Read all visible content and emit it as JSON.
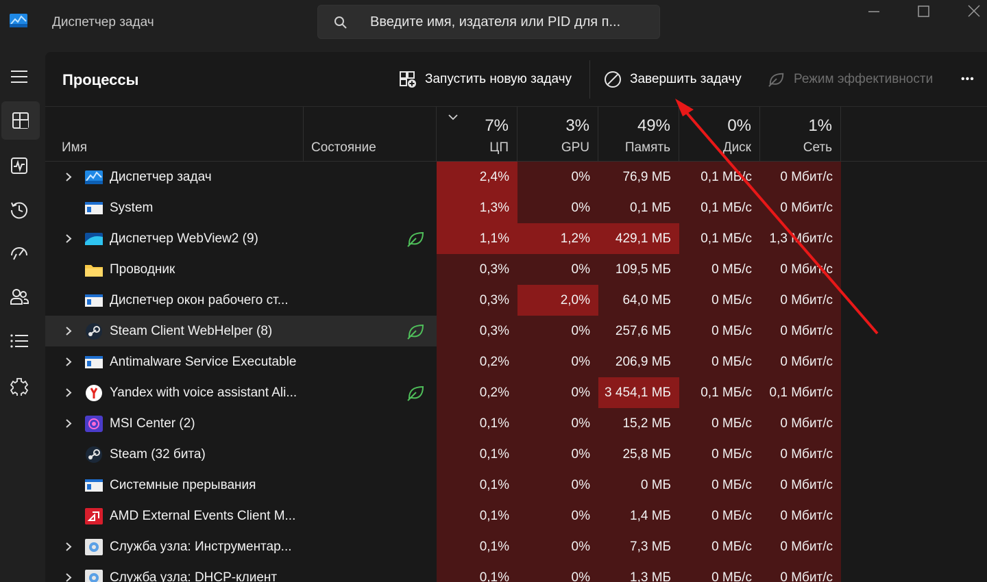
{
  "window": {
    "title": "Диспетчер задач",
    "search_placeholder": "Введите имя, издателя или PID для п..."
  },
  "nav": {
    "items": [
      {
        "icon": "hamburger-icon"
      },
      {
        "icon": "processes-icon",
        "active": true
      },
      {
        "icon": "performance-icon"
      },
      {
        "icon": "app-history-icon"
      },
      {
        "icon": "startup-apps-icon"
      },
      {
        "icon": "users-icon"
      },
      {
        "icon": "details-icon"
      },
      {
        "icon": "services-icon"
      }
    ]
  },
  "toolbar": {
    "title": "Процессы",
    "run_new_task": "Запустить новую задачу",
    "end_task": "Завершить задачу",
    "efficiency_mode": "Режим эффективности",
    "more": "•••"
  },
  "columns": {
    "name": "Имя",
    "status": "Состояние",
    "cpu": {
      "pct": "7%",
      "label": "ЦП"
    },
    "gpu": {
      "pct": "3%",
      "label": "GPU"
    },
    "memory": {
      "pct": "49%",
      "label": "Память"
    },
    "disk": {
      "pct": "0%",
      "label": "Диск"
    },
    "network": {
      "pct": "1%",
      "label": "Сеть"
    }
  },
  "colors": {
    "heat_low": "#4a1616",
    "heat_mid": "#6e1818",
    "heat_high": "#8a1a1a",
    "arrow": "#e81818"
  },
  "processes": [
    {
      "name": "Диспетчер задач",
      "icon": "taskmanager-icon",
      "expand": true,
      "eco": false,
      "cpu": "2,4%",
      "gpu": "0%",
      "mem": "76,9 МБ",
      "disk": "0,1 МБ/с",
      "net": "0 Мбит/с",
      "heat": {
        "cpu": 3,
        "gpu": 1,
        "mem": 1,
        "disk": 1,
        "net": 1
      }
    },
    {
      "name": "System",
      "icon": "system-window-icon",
      "expand": false,
      "eco": false,
      "cpu": "1,3%",
      "gpu": "0%",
      "mem": "0,1 МБ",
      "disk": "0,1 МБ/с",
      "net": "0 Мбит/с",
      "heat": {
        "cpu": 3,
        "gpu": 1,
        "mem": 1,
        "disk": 1,
        "net": 1
      }
    },
    {
      "name": "Диспетчер WebView2 (9)",
      "icon": "webview-icon",
      "expand": true,
      "eco": true,
      "cpu": "1,1%",
      "gpu": "1,2%",
      "mem": "429,1 МБ",
      "disk": "0,1 МБ/с",
      "net": "1,3 Мбит/с",
      "heat": {
        "cpu": 3,
        "gpu": 3,
        "mem": 3,
        "disk": 1,
        "net": 1
      }
    },
    {
      "name": "Проводник",
      "icon": "folder-icon",
      "expand": false,
      "eco": false,
      "cpu": "0,3%",
      "gpu": "0%",
      "mem": "109,5 МБ",
      "disk": "0 МБ/с",
      "net": "0 Мбит/с",
      "heat": {
        "cpu": 1,
        "gpu": 1,
        "mem": 1,
        "disk": 1,
        "net": 1
      }
    },
    {
      "name": "Диспетчер окон рабочего ст...",
      "icon": "system-window-icon",
      "expand": false,
      "eco": false,
      "cpu": "0,3%",
      "gpu": "2,0%",
      "mem": "64,0 МБ",
      "disk": "0 МБ/с",
      "net": "0 Мбит/с",
      "heat": {
        "cpu": 1,
        "gpu": 3,
        "mem": 1,
        "disk": 1,
        "net": 1
      }
    },
    {
      "name": "Steam Client WebHelper (8)",
      "icon": "steam-icon",
      "expand": true,
      "eco": true,
      "hover": true,
      "cpu": "0,3%",
      "gpu": "0%",
      "mem": "257,6 МБ",
      "disk": "0 МБ/с",
      "net": "0 Мбит/с",
      "heat": {
        "cpu": 1,
        "gpu": 1,
        "mem": 1,
        "disk": 1,
        "net": 1
      }
    },
    {
      "name": "Antimalware Service Executable",
      "icon": "system-window-icon",
      "expand": true,
      "eco": false,
      "cpu": "0,2%",
      "gpu": "0%",
      "mem": "206,9 МБ",
      "disk": "0 МБ/с",
      "net": "0 Мбит/с",
      "heat": {
        "cpu": 1,
        "gpu": 1,
        "mem": 1,
        "disk": 1,
        "net": 1
      }
    },
    {
      "name": "Yandex with voice assistant Ali...",
      "icon": "yandex-icon",
      "expand": true,
      "eco": true,
      "cpu": "0,2%",
      "gpu": "0%",
      "mem": "3 454,1 МБ",
      "disk": "0,1 МБ/с",
      "net": "0,1 Мбит/с",
      "heat": {
        "cpu": 1,
        "gpu": 1,
        "mem": 3,
        "disk": 1,
        "net": 1
      }
    },
    {
      "name": "MSI Center (2)",
      "icon": "msi-icon",
      "expand": true,
      "eco": false,
      "cpu": "0,1%",
      "gpu": "0%",
      "mem": "15,2 МБ",
      "disk": "0 МБ/с",
      "net": "0 Мбит/с",
      "heat": {
        "cpu": 1,
        "gpu": 1,
        "mem": 1,
        "disk": 1,
        "net": 1
      }
    },
    {
      "name": "Steam (32 бита)",
      "icon": "steam-icon",
      "expand": false,
      "eco": false,
      "cpu": "0,1%",
      "gpu": "0%",
      "mem": "25,8 МБ",
      "disk": "0 МБ/с",
      "net": "0 Мбит/с",
      "heat": {
        "cpu": 1,
        "gpu": 1,
        "mem": 1,
        "disk": 1,
        "net": 1
      }
    },
    {
      "name": "Системные прерывания",
      "icon": "system-window-icon",
      "expand": false,
      "eco": false,
      "cpu": "0,1%",
      "gpu": "0%",
      "mem": "0 МБ",
      "disk": "0 МБ/с",
      "net": "0 Мбит/с",
      "heat": {
        "cpu": 1,
        "gpu": 1,
        "mem": 1,
        "disk": 1,
        "net": 1
      }
    },
    {
      "name": "AMD External Events Client M...",
      "icon": "amd-icon",
      "expand": false,
      "eco": false,
      "cpu": "0,1%",
      "gpu": "0%",
      "mem": "1,4 МБ",
      "disk": "0 МБ/с",
      "net": "0 Мбит/с",
      "heat": {
        "cpu": 1,
        "gpu": 1,
        "mem": 1,
        "disk": 1,
        "net": 1
      }
    },
    {
      "name": "Служба узла: Инструментар...",
      "icon": "service-gear-icon",
      "expand": true,
      "eco": false,
      "cpu": "0,1%",
      "gpu": "0%",
      "mem": "7,3 МБ",
      "disk": "0 МБ/с",
      "net": "0 Мбит/с",
      "heat": {
        "cpu": 1,
        "gpu": 1,
        "mem": 1,
        "disk": 1,
        "net": 1
      }
    },
    {
      "name": "Служба узла: DHCP-клиент",
      "icon": "service-gear-icon",
      "expand": true,
      "eco": false,
      "cpu": "0,1%",
      "gpu": "0%",
      "mem": "1,3 МБ",
      "disk": "0 МБ/с",
      "net": "0 Мбит/с",
      "heat": {
        "cpu": 1,
        "gpu": 1,
        "mem": 1,
        "disk": 1,
        "net": 1
      }
    }
  ]
}
